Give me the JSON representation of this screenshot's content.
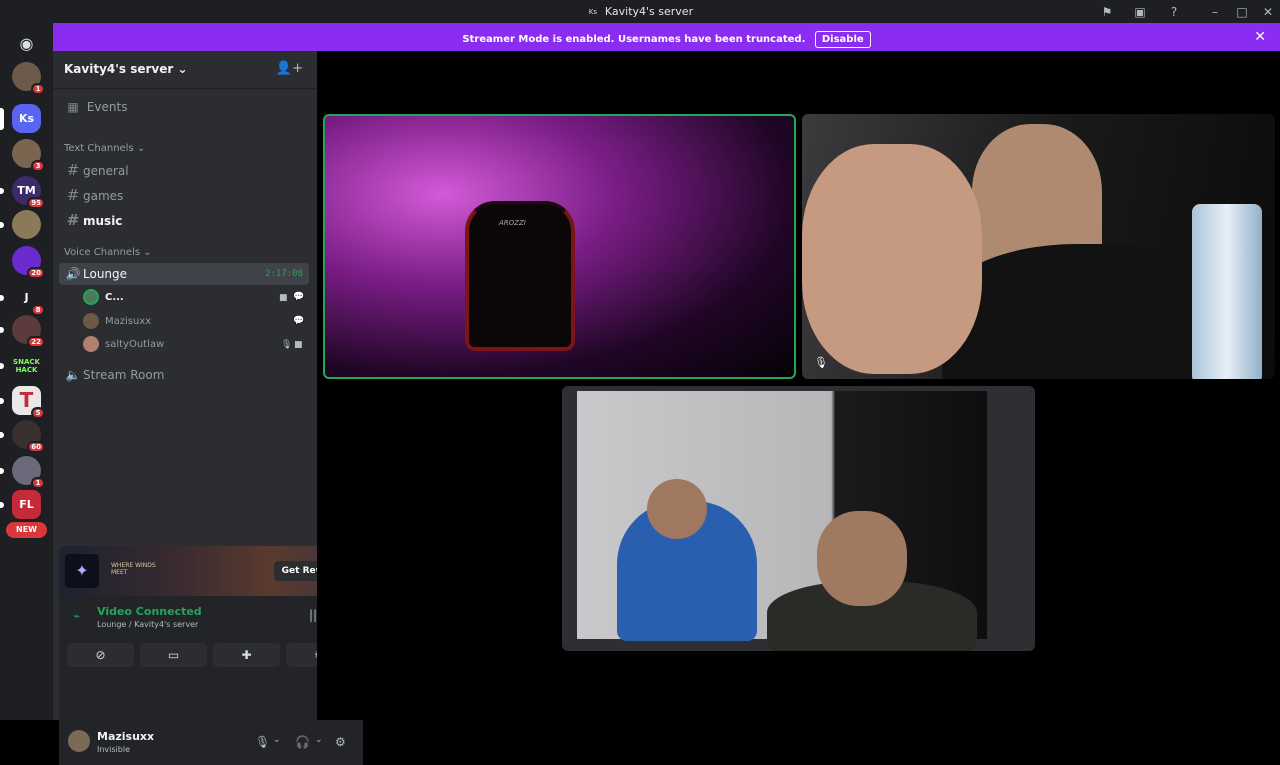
{
  "window": {
    "title": "Kavity4's server",
    "title_icon": "Ks"
  },
  "banner": {
    "message": "Streamer Mode is enabled. Usernames have been truncated.",
    "button": "Disable"
  },
  "guilds": [
    {
      "name": "user-1",
      "label": "",
      "badge": "1",
      "color": "#6d5a4a"
    },
    {
      "name": "ks-server",
      "label": "Ks",
      "badge": "",
      "color": "#5865f2"
    },
    {
      "name": "guild-3",
      "label": "",
      "badge": "3",
      "color": "#7a6650"
    },
    {
      "name": "guild-tm",
      "label": "TM",
      "badge": "95",
      "color": "#3d2a6b"
    },
    {
      "name": "guild-5",
      "label": "",
      "badge": "",
      "color": "#8a7a5a"
    },
    {
      "name": "guild-6",
      "label": "",
      "badge": "20",
      "color": "#6a2ad0"
    },
    {
      "name": "guild-j",
      "label": "J",
      "badge": "8",
      "color": "#1e1f22"
    },
    {
      "name": "guild-8",
      "label": "",
      "badge": "22",
      "color": "#5a3a3a"
    },
    {
      "name": "guild-snack",
      "label": "SNACK HACK",
      "badge": "",
      "color": "#1e1f22"
    },
    {
      "name": "guild-t",
      "label": "T",
      "badge": "5",
      "color": "#e8e8e8"
    },
    {
      "name": "guild-11",
      "label": "",
      "badge": "60",
      "color": "#3a3030"
    },
    {
      "name": "guild-12",
      "label": "",
      "badge": "1",
      "color": "#6a6a7a"
    },
    {
      "name": "guild-fl",
      "label": "FL",
      "badge": "",
      "color": "#c42a3a"
    }
  ],
  "guild_new": "NEW",
  "server": {
    "name": "Kavity4's server"
  },
  "sidebar": {
    "events": "Events",
    "text_category": "Text Channels",
    "text_channels": [
      "general",
      "games",
      "music"
    ],
    "voice_category": "Voice Channels",
    "voice_channels": [
      {
        "name": "Lounge",
        "timer": "2:17:08"
      },
      {
        "name": "Stream Room"
      }
    ],
    "voice_users": [
      "C...",
      "Mazisuxx",
      "saltyOutlaw"
    ]
  },
  "promo": {
    "brand": "WHERE WINDS MEET",
    "button": "Get Reward!"
  },
  "voice_panel": {
    "status": "Video Connected",
    "location": "Lounge / Kavity4's server"
  },
  "user": {
    "name": "Mazisuxx",
    "status": "Invisible"
  },
  "chair_brand": "AROZZI",
  "colors": {
    "accent": "#8b2df0",
    "online": "#23a55a",
    "badge": "#da373c"
  }
}
